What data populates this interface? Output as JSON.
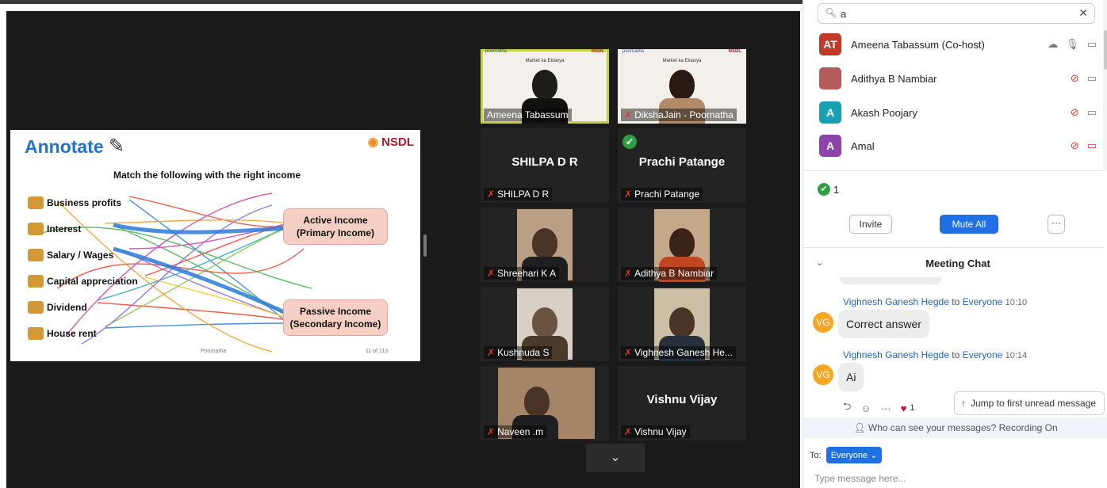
{
  "slide": {
    "title": "Annotate",
    "logo": "NSDL",
    "heading": "Match the following with the right income",
    "items": [
      "Business profits",
      "Interest",
      "Salary / Wages",
      "Capital appreciation",
      "Dividend",
      "House rent"
    ],
    "active_income": [
      "Active Income",
      "(Primary Income)"
    ],
    "passive_income": [
      "Passive Income",
      "(Secondary Income)"
    ],
    "footer": "Poornatha",
    "page": "11 of 113"
  },
  "tiles": [
    {
      "name": "Ameena Tabassum",
      "kind": "slide",
      "active": true
    },
    {
      "name": "DikshaJain - Poornatha",
      "kind": "slide"
    },
    {
      "name": "SHILPA D R",
      "kind": "name",
      "center": "SHILPA D R"
    },
    {
      "name": "Prachi Patange",
      "kind": "name",
      "center": "Prachi Patange",
      "check": true
    },
    {
      "name": "Shreehari K A",
      "kind": "video"
    },
    {
      "name": "Adithya B Nambiar",
      "kind": "video"
    },
    {
      "name": "Kushnuda S",
      "kind": "video"
    },
    {
      "name": "Vighnesh Ganesh He...",
      "kind": "video"
    },
    {
      "name": "Naveen .m",
      "kind": "video"
    },
    {
      "name": "Vishnu Vijay",
      "kind": "name",
      "center": "Vishnu Vijay"
    }
  ],
  "panel": {
    "search_value": "a",
    "participants": [
      {
        "initials": "AT",
        "name": "Ameena Tabassum (Co-host)",
        "color": "#c0392b",
        "muted": false
      },
      {
        "initials": "",
        "name": "Adithya B Nambiar",
        "color": "#b65b5b",
        "muted": true
      },
      {
        "initials": "A",
        "name": "Akash Poojary",
        "color": "#1aa0b5",
        "muted": true
      },
      {
        "initials": "A",
        "name": "Amal",
        "color": "#8e44ad",
        "muted": true
      }
    ],
    "check_count": "1",
    "invite": "Invite",
    "mute_all": "Mute All",
    "more": "···"
  },
  "chat": {
    "title": "Meeting Chat",
    "messages": [
      {
        "sender": "Vighnesh Ganesh Hegde",
        "to": "to",
        "recipient": "Everyone",
        "time": "10:10",
        "initials": "VG",
        "text": "Correct answer"
      },
      {
        "sender": "Vighnesh Ganesh Hegde",
        "to": "to",
        "recipient": "Everyone",
        "time": "10:14",
        "initials": "VG",
        "text": "Ai"
      }
    ],
    "reaction_count": "1",
    "jump_label": "Jump to first unread message",
    "privacy": "Who can see your messages? Recording On",
    "to_label": "To:",
    "to_value": "Everyone",
    "input_placeholder": "Type message here..."
  }
}
